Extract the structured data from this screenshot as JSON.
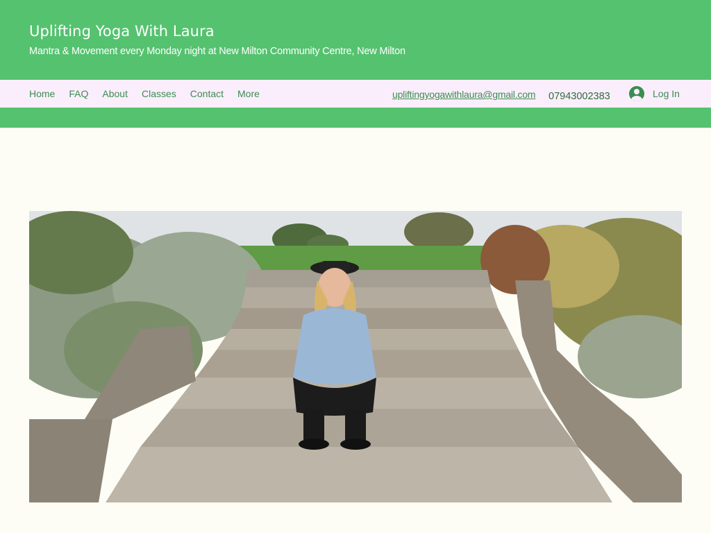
{
  "header": {
    "title": "Uplifting Yoga With Laura",
    "tagline": "Mantra & Movement every Monday night at New Milton Community Centre, New Milton"
  },
  "nav": {
    "items": [
      {
        "label": "Home"
      },
      {
        "label": "FAQ"
      },
      {
        "label": "About"
      },
      {
        "label": "Classes"
      },
      {
        "label": "Contact"
      },
      {
        "label": "More"
      }
    ]
  },
  "contact": {
    "email": "upliftingyogawithlaura@gmail.com",
    "phone": "07943002383"
  },
  "login": {
    "label": "Log In",
    "icon": "account-avatar-icon"
  },
  "colors": {
    "header_green": "#55c26f",
    "nav_bg": "#fbeefc",
    "page_bg": "#fdfdf6",
    "link_green": "#3a8d4f"
  }
}
